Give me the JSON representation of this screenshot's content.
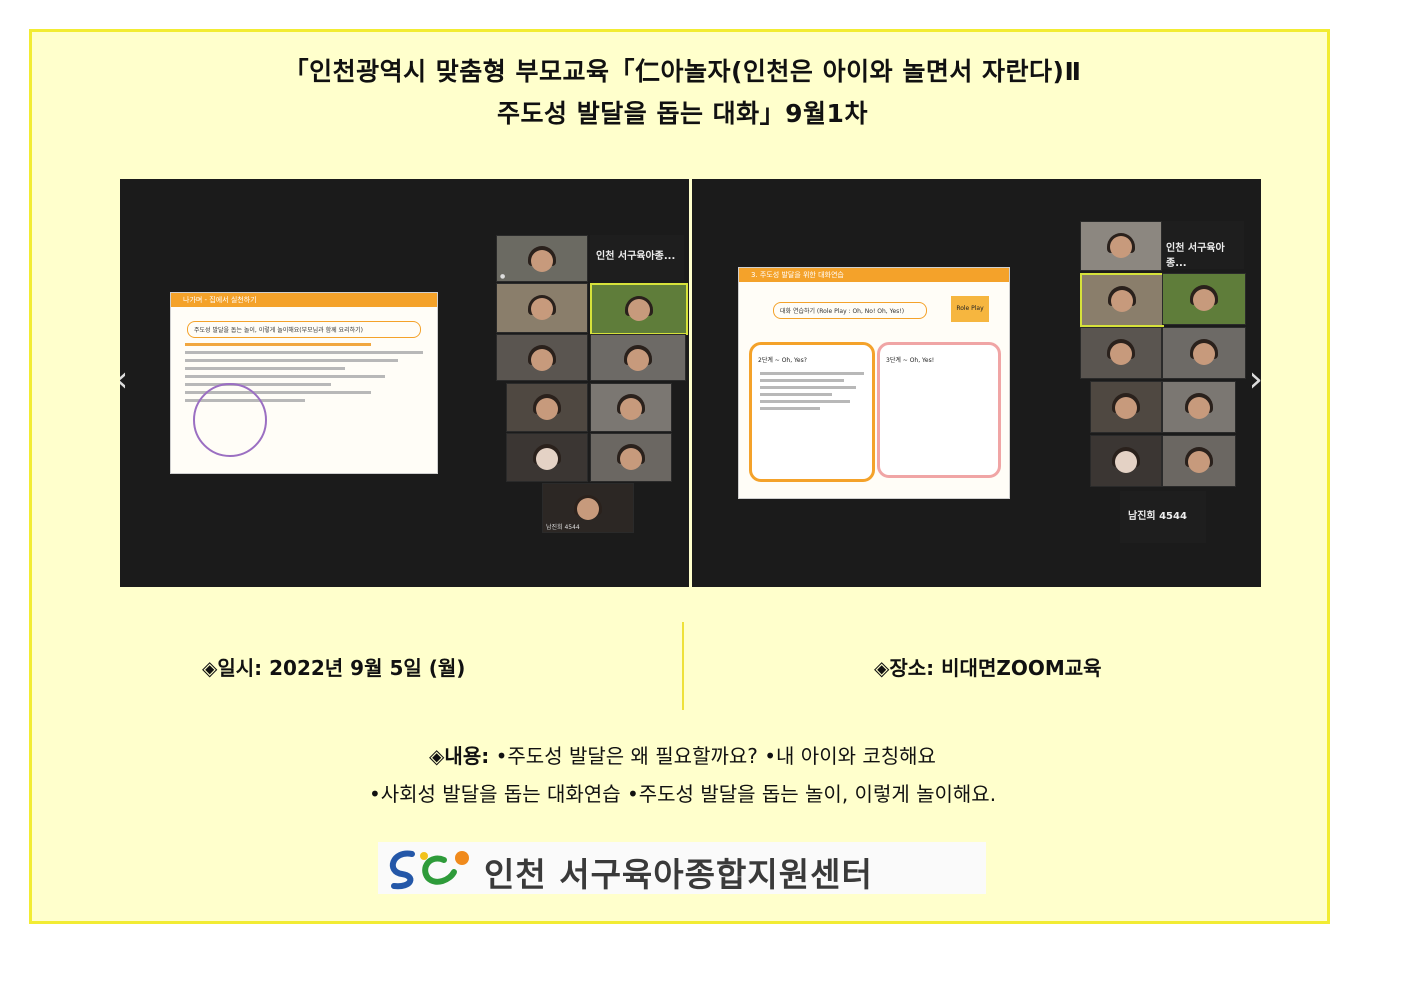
{
  "title": {
    "line1": "「인천광역시 맞춤형 부모교육「仁아놀자(인천은 아이와 놀면서 자란다)Ⅱ",
    "line2": "주도성 발달을 돕는 대화」9월1차"
  },
  "screenshots": {
    "left": {
      "slide_header": "나가며 - 집에서 실천하기",
      "slide_topic": "주도성 발달을 돕는 놀이, 이렇게 놀이해요(부모님과 함께 요리하기)",
      "host_tile": "인천 서구육아종...",
      "participant_last": "남진희 4544"
    },
    "right": {
      "slide_header": "3. 주도성 발달을 위한 대화연습",
      "slide_topic": "대화 연습하기 (Role Play : Oh, No! Oh, Yes!)",
      "role_play_badge": "Role Play",
      "step2": "2단계 ~ Oh, Yes?",
      "step3": "3단계 ~ Oh, Yes!",
      "host_tile": "인천 서구육아종...",
      "participant_last": "남진희 4544"
    }
  },
  "info": {
    "date_label": "◈일시: 2022년 9월 5일 (월)",
    "place_label": "◈장소: 비대면ZOOM교육"
  },
  "content": {
    "label": "◈내용:",
    "line1_items": "•주도성 발달은 왜 필요할까요?  •내 아이와 코칭해요",
    "line2_items": "•사회성 발달을 돕는 대화연습 •주도성 발달을 돕는 놀이, 이렇게 놀이해요."
  },
  "logo": {
    "text": "인천 서구육아종합지원센터"
  },
  "colors": {
    "card_bg": "#ffffcc",
    "card_border": "#f2ec33",
    "slide_accent": "#f4a22a"
  }
}
